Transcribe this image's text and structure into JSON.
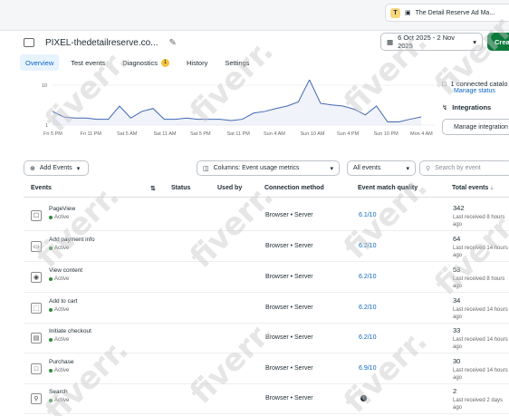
{
  "account": {
    "initial": "T",
    "name": "The Detail Reserve Ad Ma..."
  },
  "header": {
    "title": "PIXEL-thedetailreserve.co...",
    "date_range": "6 Oct 2025 - 2 Nov 2025",
    "create_label": "Creat"
  },
  "tabs": [
    {
      "label": "Overview",
      "badge": ""
    },
    {
      "label": "Test events",
      "badge": ""
    },
    {
      "label": "Diagnostics",
      "badge": "1"
    },
    {
      "label": "History",
      "badge": ""
    },
    {
      "label": "Settings",
      "badge": ""
    }
  ],
  "side": {
    "connected": "1 connected catalo",
    "manage_status": "Manage status",
    "integrations": "Integrations",
    "manage_integrations": "Manage integration"
  },
  "chart_data": {
    "type": "line",
    "y_ticks": [
      "10",
      "1"
    ],
    "x_tick_labels": [
      "Fri 5 PM",
      "Fri 11 PM",
      "Sat 5 AM",
      "Sat 11 AM",
      "Sat 5 PM",
      "Sat 11 PM",
      "Sun 4 AM",
      "Sun 10 AM",
      "Sun 4 PM",
      "Sun 10 PM",
      "Mon 4 AM"
    ],
    "series": [
      {
        "values": [
          2.2,
          1.6,
          1.5,
          1.5,
          1.4,
          1.4,
          3.0,
          1.5,
          2.2,
          2.6,
          1.4,
          1.4,
          1.5,
          1.4,
          1.4,
          1.4,
          1.3,
          1.4,
          2.0,
          2.2,
          2.6,
          3.0,
          3.8,
          14,
          3.5,
          3.2,
          3.0,
          2.5,
          1.8,
          3.0,
          1.2,
          1.2,
          1.4,
          1.6
        ]
      }
    ]
  },
  "filters": {
    "add_events": "Add Events",
    "columns": "Columns: Event usage metrics",
    "all_events": "All events",
    "search_placeholder": "Search by event"
  },
  "table": {
    "headers": {
      "events": "Events",
      "status": "Status",
      "used_by": "Used by",
      "connection": "Connection method",
      "emq": "Event match quality",
      "total": "Total events ↓"
    },
    "rows": [
      {
        "name": "PageView",
        "status": "Active",
        "icon": "☐",
        "connection": "Browser • Server",
        "emq": "6.1/10",
        "total": "342",
        "last": "Last received 8 hours ago"
      },
      {
        "name": "Add payment info",
        "status": "Active",
        "icon": "▭",
        "connection": "Browser • Server",
        "emq": "6.2/10",
        "total": "64",
        "last": "Last received 14 hours ago"
      },
      {
        "name": "View content",
        "status": "Active",
        "icon": "◉",
        "connection": "Browser • Server",
        "emq": "6.2/10",
        "total": "53",
        "last": "Last received 8 hours ago"
      },
      {
        "name": "Add to cart",
        "status": "Active",
        "icon": "⬚",
        "connection": "Browser • Server",
        "emq": "6.2/10",
        "total": "34",
        "last": "Last received 14 hours ago"
      },
      {
        "name": "Initiate checkout",
        "status": "Active",
        "icon": "▤",
        "connection": "Browser • Server",
        "emq": "6.2/10",
        "total": "33",
        "last": "Last received 14 hours ago"
      },
      {
        "name": "Purchase",
        "status": "Active",
        "icon": "□",
        "connection": "Browser • Server",
        "emq": "6.9/10",
        "total": "30",
        "last": "Last received 14 hours ago"
      },
      {
        "name": "Search",
        "status": "Active",
        "icon": "⚲",
        "connection": "Browser • Server",
        "emq": "",
        "total": "2",
        "last": "Last received 2 days ago"
      }
    ]
  },
  "watermark": "fiverr."
}
